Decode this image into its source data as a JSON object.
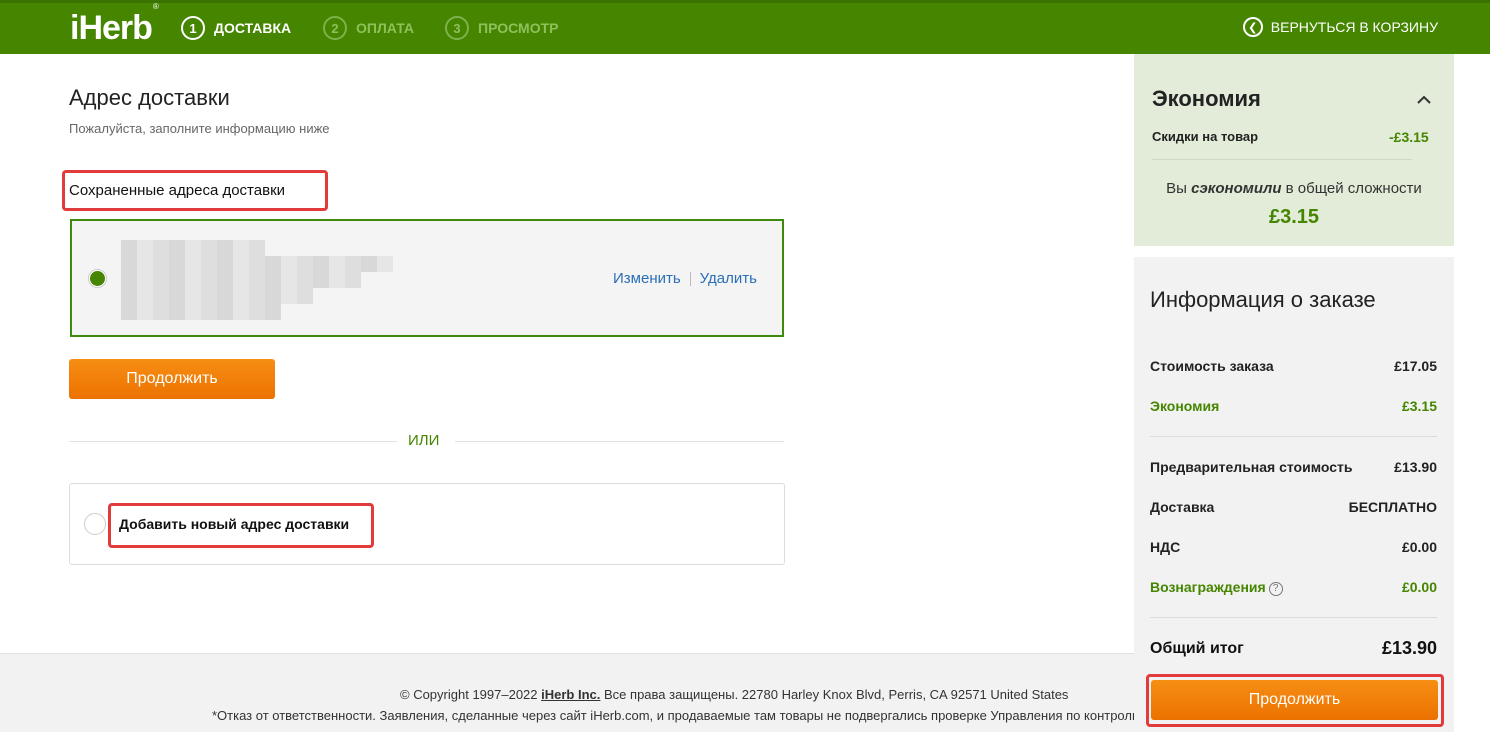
{
  "header": {
    "logo": "iHerb",
    "logo_mark": "®",
    "steps": [
      {
        "num": "1",
        "label": "ДОСТАВКА"
      },
      {
        "num": "2",
        "label": "ОПЛАТА"
      },
      {
        "num": "3",
        "label": "ПРОСМОТР"
      }
    ],
    "back_label": "ВЕРНУТЬСЯ В КОРЗИНУ",
    "colors": {
      "bar": "#458500",
      "active": "#ffffff",
      "inactive": "#8fc15a"
    }
  },
  "shipping": {
    "title": "Адрес доставки",
    "subtitle": "Пожалуйста, заполните информацию ниже",
    "saved_heading": "Сохраненные адреса доставки",
    "edit_label": "Изменить",
    "delete_label": "Удалить",
    "continue_label": "Продолжить",
    "or_label": "ИЛИ",
    "add_new_label": "Добавить новый адрес доставки"
  },
  "savings": {
    "title": "Экономия",
    "discount_label": "Скидки на товар",
    "discount_value": "-£3.15",
    "saved_prefix": "Вы",
    "saved_em": "сэкономили",
    "saved_middle": "в общей сложности",
    "saved_amount": "£3.15"
  },
  "order": {
    "title": "Информация о заказе",
    "rows": {
      "cost": {
        "label": "Стоимость заказа",
        "value": "£17.05"
      },
      "economy": {
        "label": "Экономия",
        "value": "£3.15"
      },
      "subtotal": {
        "label": "Предварительная стоимость",
        "value": "£13.90"
      },
      "delivery": {
        "label": "Доставка",
        "value": "БЕСПЛАТНО"
      },
      "vat": {
        "label": "НДС",
        "value": "£0.00"
      },
      "rewards": {
        "label": "Вознаграждения",
        "value": "£0.00"
      }
    },
    "total_label": "Общий итог",
    "total_value": "£13.90",
    "continue_label": "Продолжить"
  },
  "footer": {
    "copyright_prefix": "© Copyright 1997–2022",
    "company": "iHerb Inc.",
    "copyright_suffix": "Все права защищены. 22780 Harley Knox Blvd, Perris, CA 92571 United States",
    "disclaimer": "*Отказ от ответственности. Заявления, сделанные через сайт iHerb.com, и продаваемые там товары не подвергались проверке Управления по контролю за продуктами и лекарствами США"
  }
}
